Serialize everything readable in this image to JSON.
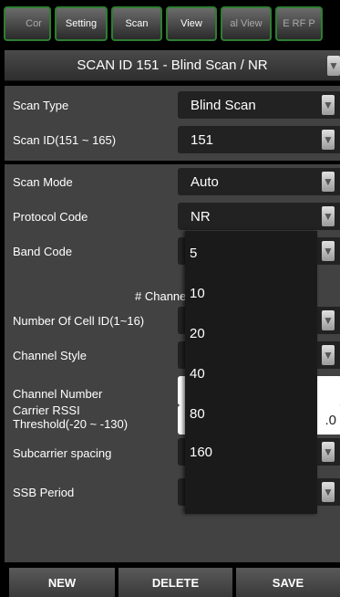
{
  "tabs": [
    {
      "label": "Cor",
      "state": "partial"
    },
    {
      "label": "Setting",
      "state": "normal"
    },
    {
      "label": "Scan",
      "state": "normal"
    },
    {
      "label": "View",
      "state": "normal"
    },
    {
      "label": "al View",
      "state": "partial"
    },
    {
      "label": "E RF P",
      "state": "partial"
    }
  ],
  "title": "SCAN ID 151 - Blind Scan / NR",
  "panel1": {
    "scan_type": {
      "label": "Scan Type",
      "value": "Blind Scan"
    },
    "scan_id": {
      "label": "Scan ID(151 ~ 165)",
      "value": "151"
    }
  },
  "panel2": {
    "scan_mode": {
      "label": "Scan Mode",
      "value": "Auto"
    },
    "protocol_code": {
      "label": "Protocol Code",
      "value": "NR"
    },
    "band_code": {
      "label": "Band Code"
    },
    "channel_header": "# Channe",
    "num_cell_id": {
      "label": "Number Of Cell ID(1~16)"
    },
    "channel_style": {
      "label": "Channel Style"
    },
    "channel_number": {
      "label": "Channel Number"
    },
    "carrier_rssi": {
      "label_line1": "Carrier RSSI",
      "label_line2": "Threshold(-20 ~ -130)",
      "value_tail": ".0"
    },
    "subcarrier_spacing": {
      "label": "Subcarrier spacing"
    },
    "ssb_period": {
      "label": "SSB Period",
      "value": "5"
    }
  },
  "dropdown_options": [
    "5",
    "10",
    "20",
    "40",
    "80",
    "160"
  ],
  "buttons": {
    "new": "NEW",
    "delete": "DELETE",
    "save": "SAVE"
  },
  "colors": {
    "tab_border": "#2e7d32",
    "panel_bg": "#424242",
    "field_bg": "#222222"
  }
}
